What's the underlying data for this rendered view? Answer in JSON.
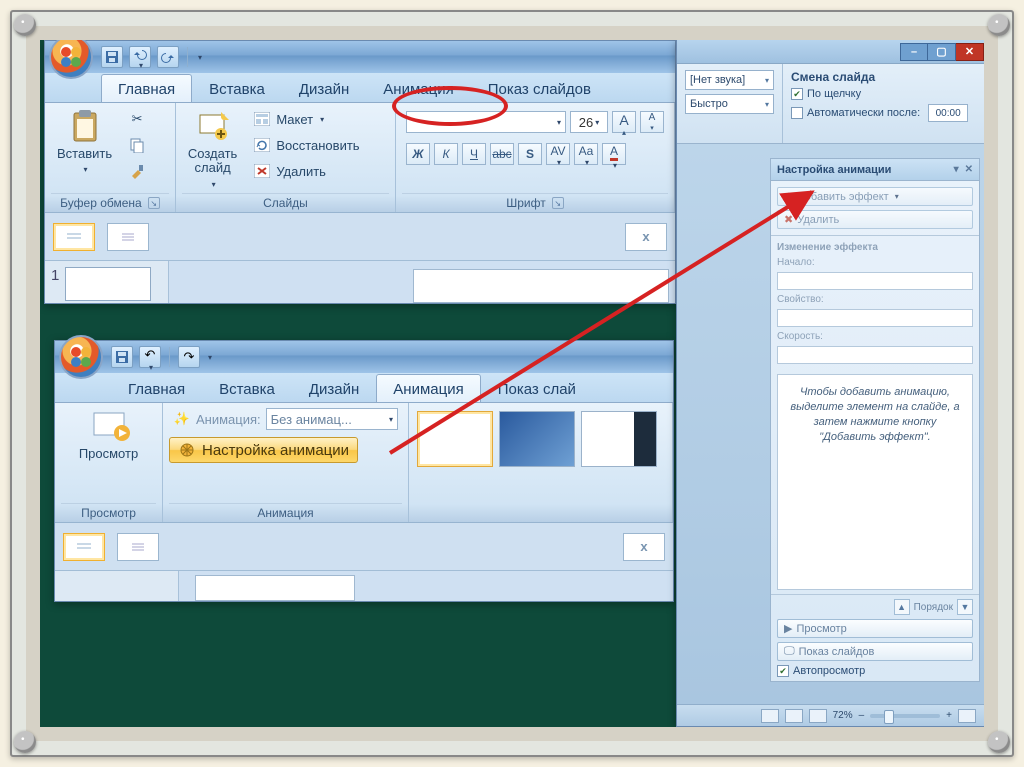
{
  "tabs": {
    "home": "Главная",
    "insert": "Вставка",
    "design": "Дизайн",
    "animation": "Анимация",
    "slideshow": "Показ слайдов",
    "slideshow_short": "Показ слай"
  },
  "ribbon1": {
    "paste": "Вставить",
    "clipboard_group": "Буфер обмена",
    "newslide": "Создать\nслайд",
    "layout": "Макет",
    "reset": "Восстановить",
    "delete": "Удалить",
    "slides_group": "Слайды",
    "font_size": "26",
    "font_group": "Шрифт"
  },
  "thumb": {
    "index": "1"
  },
  "ribbon2": {
    "preview": "Просмотр",
    "preview_group": "Просмотр",
    "anim_label": "Анимация:",
    "anim_value": "Без анимац...",
    "custom_anim": "Настройка анимации",
    "anim_group": "Анимация"
  },
  "rightpane": {
    "sound_combo": "[Нет звука]",
    "speed_combo": "Быстро",
    "advance_title": "Смена слайда",
    "onclick": "По щелчку",
    "after": "Автоматически после:",
    "after_time": "00:00"
  },
  "taskpane": {
    "title": "Настройка анимации",
    "add_effect": "Добавить эффект",
    "remove": "Удалить",
    "modify": "Изменение эффекта",
    "start": "Начало:",
    "property": "Свойство:",
    "speed": "Скорость:",
    "hint": "Чтобы добавить анимацию, выделите элемент на слайде, а затем нажмите кнопку \"Добавить эффект\".",
    "order": "Порядок",
    "play": "Просмотр",
    "slideshow": "Показ слайдов",
    "autopreview": "Автопросмотр"
  },
  "status": {
    "zoom": "72%"
  }
}
